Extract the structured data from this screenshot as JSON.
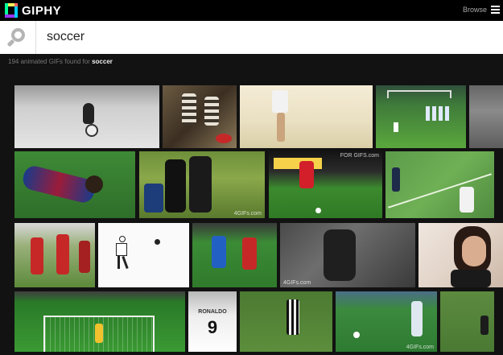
{
  "header": {
    "logo_text": "GIPHY",
    "browse_label": "Browse"
  },
  "search": {
    "query": "soccer"
  },
  "results": {
    "count_text": "194 animated GIFs found for",
    "term": "soccer"
  },
  "watermarks": {
    "w1": "4GIFs.com",
    "w2": "FOR GIFS.com",
    "w3": "4GIFs.com",
    "w4": "4GIFs.com",
    "w5": "4GIFs.com"
  },
  "colors": {
    "topbar": "#000000",
    "background": "#121212",
    "logo_green": "#00ff99",
    "logo_purple": "#9933ff",
    "logo_blue": "#00ccff",
    "logo_yellow": "#fff35c",
    "pitch_green": "#4a8d3a"
  }
}
